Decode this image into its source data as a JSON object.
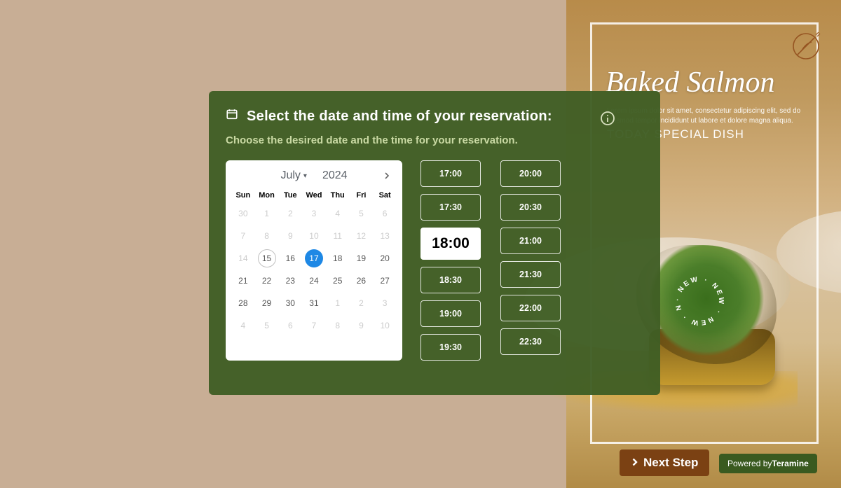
{
  "hero": {
    "dish_title": "Baked Salmon",
    "desc": "Lorem ipsum dolor sit amet, consectetur adipiscing elit, sed do eiusmod tempor incididunt ut labore et dolore magna aliqua.",
    "subtitle": "TODAY SPECIAL DISH",
    "badge_token": "· NEW "
  },
  "card": {
    "title": "Select the date and time of your reservation:",
    "subtitle": "Choose the desired date and the time for your reservation."
  },
  "calendar": {
    "month_label": "July",
    "year_label": "2024",
    "dow": [
      "Sun",
      "Mon",
      "Tue",
      "Wed",
      "Thu",
      "Fri",
      "Sat"
    ],
    "selected_day": 17,
    "outline_day": 15,
    "weeks": [
      [
        {
          "d": 30,
          "out": true
        },
        {
          "d": 1,
          "past": true
        },
        {
          "d": 2,
          "past": true
        },
        {
          "d": 3,
          "past": true
        },
        {
          "d": 4,
          "past": true
        },
        {
          "d": 5,
          "past": true
        },
        {
          "d": 6,
          "past": true
        }
      ],
      [
        {
          "d": 7,
          "past": true
        },
        {
          "d": 8,
          "past": true
        },
        {
          "d": 9,
          "past": true
        },
        {
          "d": 10,
          "past": true
        },
        {
          "d": 11,
          "past": true
        },
        {
          "d": 12,
          "past": true
        },
        {
          "d": 13,
          "past": true
        }
      ],
      [
        {
          "d": 14,
          "past": true
        },
        {
          "d": 15
        },
        {
          "d": 16
        },
        {
          "d": 17
        },
        {
          "d": 18
        },
        {
          "d": 19
        },
        {
          "d": 20
        }
      ],
      [
        {
          "d": 21
        },
        {
          "d": 22
        },
        {
          "d": 23
        },
        {
          "d": 24
        },
        {
          "d": 25
        },
        {
          "d": 26
        },
        {
          "d": 27
        }
      ],
      [
        {
          "d": 28
        },
        {
          "d": 29
        },
        {
          "d": 30
        },
        {
          "d": 31
        },
        {
          "d": 1,
          "out": true
        },
        {
          "d": 2,
          "out": true
        },
        {
          "d": 3,
          "out": true
        }
      ],
      [
        {
          "d": 4,
          "out": true
        },
        {
          "d": 5,
          "out": true
        },
        {
          "d": 6,
          "out": true
        },
        {
          "d": 7,
          "out": true
        },
        {
          "d": 8,
          "out": true
        },
        {
          "d": 9,
          "out": true
        },
        {
          "d": 10,
          "out": true
        }
      ]
    ]
  },
  "times": {
    "selected": "18:00",
    "col1": [
      "17:00",
      "17:30",
      "18:00",
      "18:30",
      "19:00",
      "19:30"
    ],
    "col2": [
      "20:00",
      "20:30",
      "21:00",
      "21:30",
      "22:00",
      "22:30"
    ]
  },
  "footer": {
    "next_label": "Next Step",
    "powered_prefix": "Powered by",
    "powered_brand": "Teramine"
  }
}
